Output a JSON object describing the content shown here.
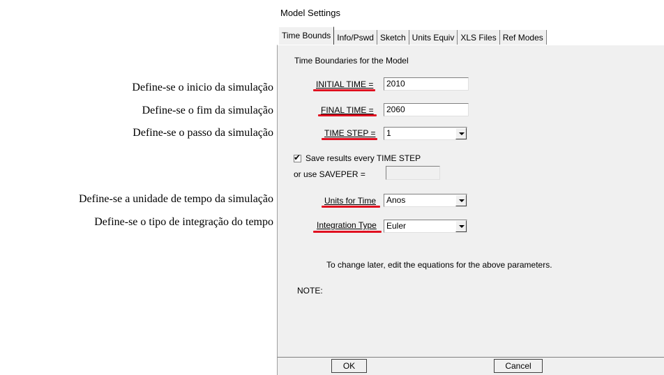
{
  "annotations": [
    "Define-se o inicio da simulação",
    "Define-se o fim da simulação",
    "Define-se o passo da simulação",
    "Define-se a unidade de tempo da simulação",
    "Define-se o tipo de integração do tempo"
  ],
  "dialog": {
    "title": "Model Settings",
    "tabs": [
      "Time Bounds",
      "Info/Pswd",
      "Sketch",
      "Units Equiv",
      "XLS Files",
      "Ref Modes"
    ],
    "active_tab": "Time Bounds",
    "section_title": "Time Boundaries for the Model",
    "initial_time": {
      "label": "INITIAL TIME =",
      "value": "2010"
    },
    "final_time": {
      "label": "FINAL TIME =",
      "value": "2060"
    },
    "time_step": {
      "label": "TIME STEP =",
      "value": "1"
    },
    "save_results": {
      "label": "Save results every TIME STEP",
      "checked": true
    },
    "saveper": {
      "label": "or use SAVEPER =",
      "value": ""
    },
    "units_for_time": {
      "label": "Units for Time",
      "value": "Anos"
    },
    "integration_type": {
      "label": "Integration Type",
      "value": "Euler"
    },
    "change_note": "To change later, edit the equations for the above parameters.",
    "note_label": "NOTE:",
    "ok_label": "OK",
    "cancel_label": "Cancel",
    "highlight_color": "#e01020"
  }
}
